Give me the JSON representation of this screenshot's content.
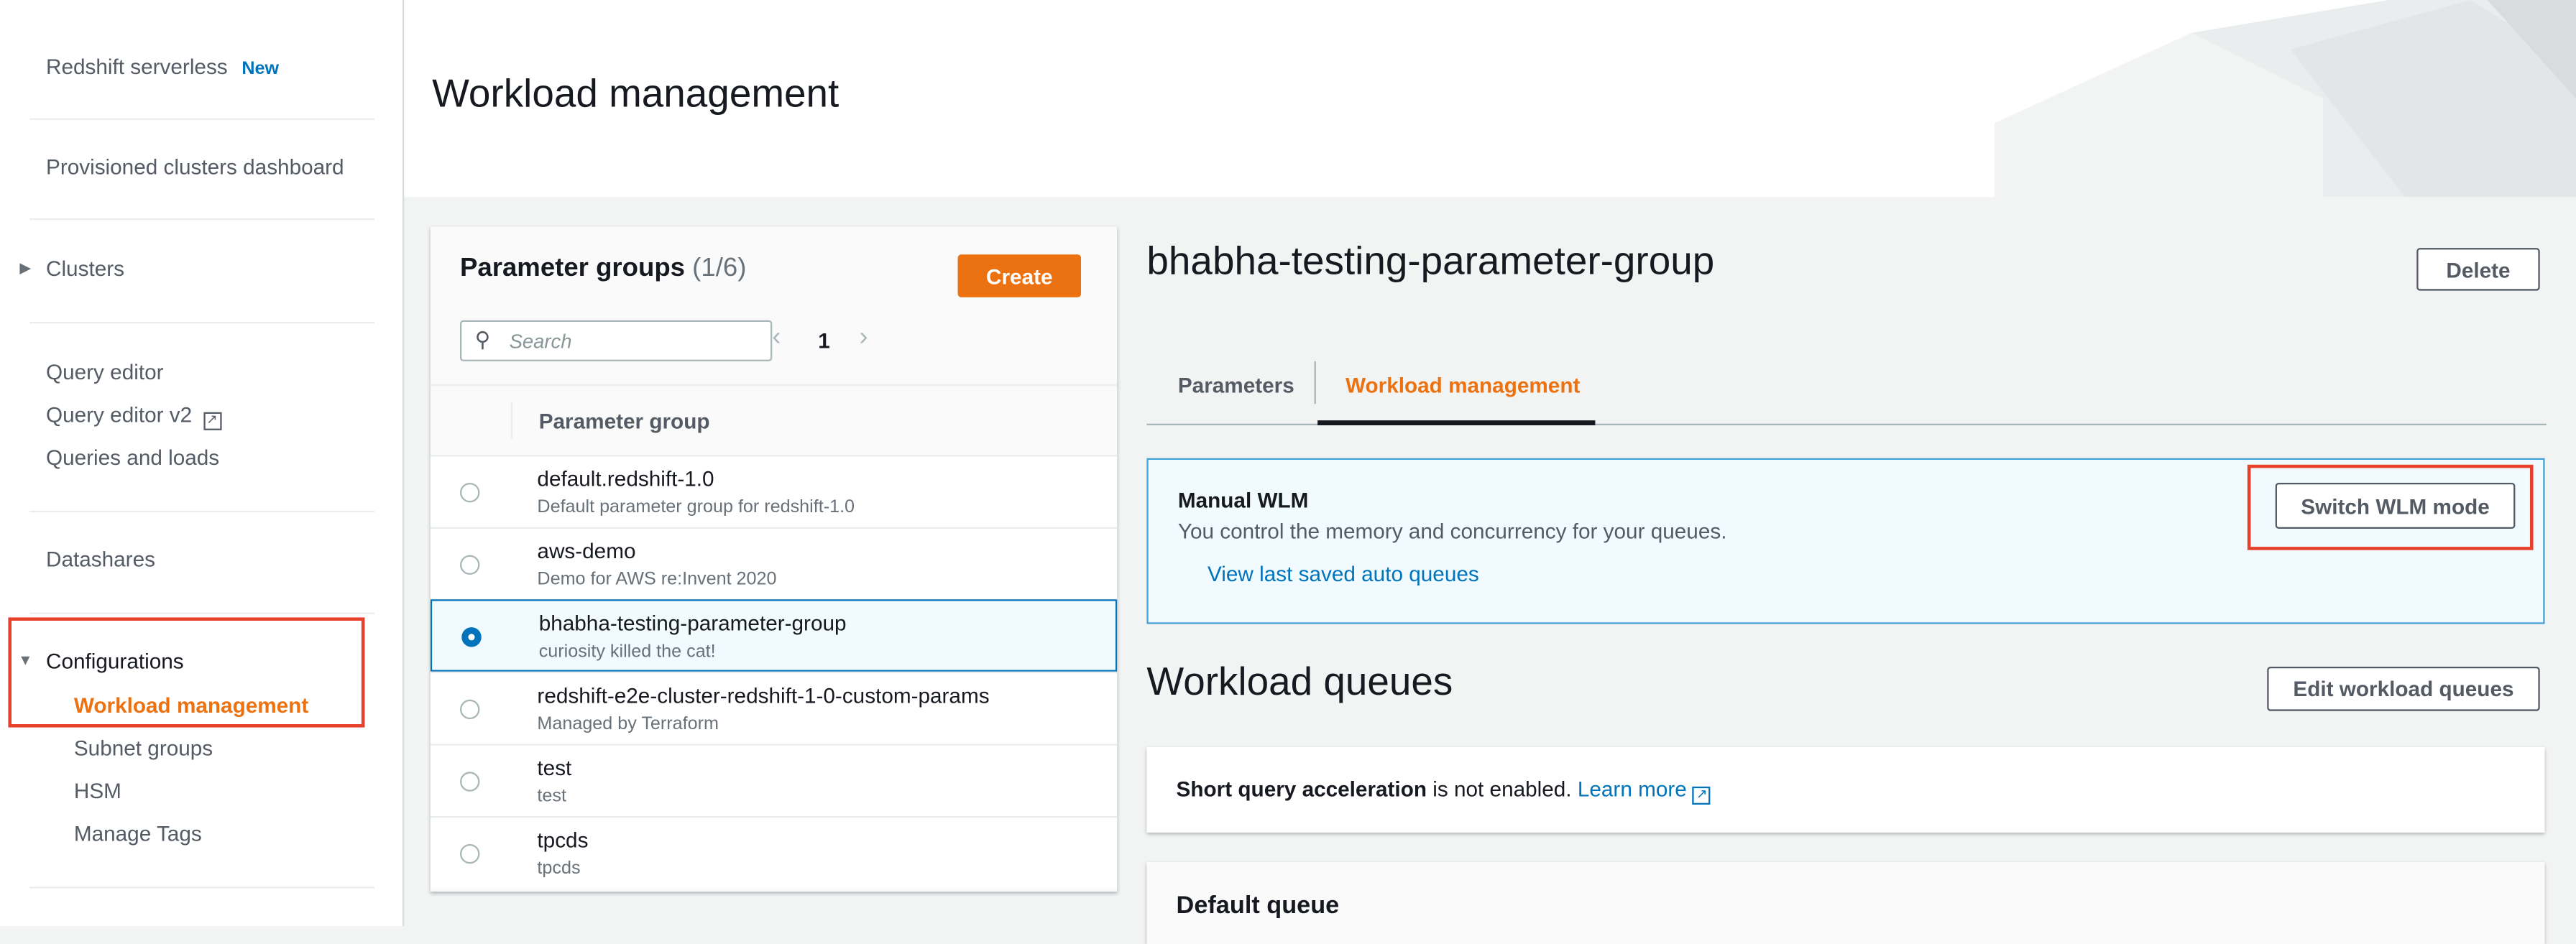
{
  "sidebar": {
    "redshift_serverless": "Redshift serverless",
    "new_badge": "New",
    "provisioned": "Provisioned clusters dashboard",
    "clusters": "Clusters",
    "query_editor": "Query editor",
    "query_editor_v2": "Query editor v2",
    "queries_loads": "Queries and loads",
    "datashares": "Datashares",
    "configurations": "Configurations",
    "config_items": [
      "Workload management",
      "Subnet groups",
      "HSM",
      "Manage Tags"
    ]
  },
  "header": {
    "title": "Workload management"
  },
  "param_groups": {
    "title": "Parameter groups",
    "count": "(1/6)",
    "create": "Create",
    "search_placeholder": "Search",
    "page": "1",
    "column": "Parameter group",
    "rows": [
      {
        "name": "default.redshift-1.0",
        "desc": "Default parameter group for redshift-1.0",
        "selected": false
      },
      {
        "name": "aws-demo",
        "desc": "Demo for AWS re:Invent 2020",
        "selected": false
      },
      {
        "name": "bhabha-testing-parameter-group",
        "desc": "curiosity killed the cat!",
        "selected": true
      },
      {
        "name": "redshift-e2e-cluster-redshift-1-0-custom-params",
        "desc": "Managed by Terraform",
        "selected": false
      },
      {
        "name": "test",
        "desc": "test",
        "selected": false
      },
      {
        "name": "tpcds",
        "desc": "tpcds",
        "selected": false
      }
    ]
  },
  "detail": {
    "title": "bhabha-testing-parameter-group",
    "delete": "Delete",
    "tabs": [
      "Parameters",
      "Workload management"
    ],
    "active_tab": "Workload management",
    "wlm_title": "Manual WLM",
    "wlm_desc": "You control the memory and concurrency for your queues.",
    "wlm_link": "View last saved auto queues",
    "switch": "Switch WLM mode",
    "queues_title": "Workload queues",
    "edit_queues": "Edit workload queues",
    "sqa_bold": "Short query acceleration",
    "sqa_rest": " is not enabled. ",
    "learn_more": "Learn more",
    "default_queue": "Default queue"
  },
  "colors": {
    "accent": "#ec7211",
    "link": "#0073bb",
    "highlight": "#e8412b"
  }
}
